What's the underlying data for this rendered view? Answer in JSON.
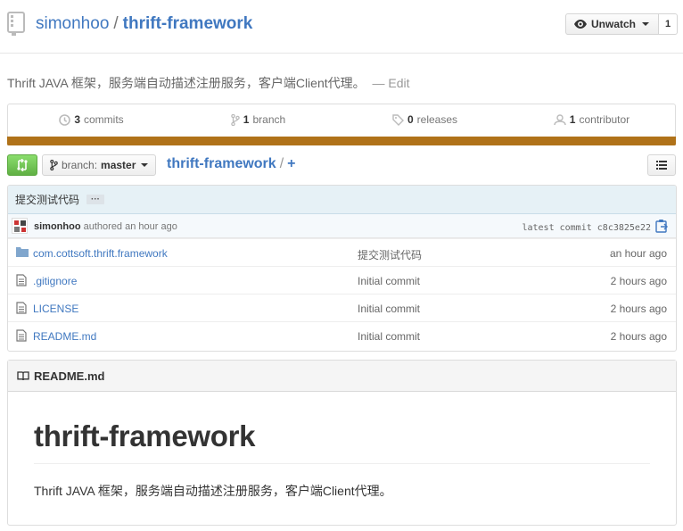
{
  "repo": {
    "owner": "simonhoo",
    "separator": "/",
    "name": "thrift-framework"
  },
  "watch": {
    "label": "Unwatch",
    "count": "1"
  },
  "description": {
    "text": "Thrift JAVA 框架，服务端自动描述注册服务，客户端Client代理。",
    "edit": "— Edit"
  },
  "summary": {
    "commits_count": "3",
    "commits_label": "commits",
    "branches_count": "1",
    "branches_label": "branch",
    "releases_count": "0",
    "releases_label": "releases",
    "contributors_count": "1",
    "contributors_label": "contributor",
    "language_color": "#b07219"
  },
  "nav": {
    "branch_label": "branch:",
    "branch_name": "master",
    "breadcrumb_root": "thrift-framework",
    "breadcrumb_sep": "/",
    "breadcrumb_add": "+"
  },
  "commit": {
    "message": "提交测试代码",
    "ellipsis": "···",
    "author": "simonhoo",
    "authored": "authored an hour ago",
    "latest_label": "latest commit",
    "sha": "c8c3825e22"
  },
  "files": [
    {
      "type": "folder-icon",
      "name": "com.cottsoft.thrift.framework",
      "message": "提交测试代码",
      "age": "an hour ago"
    },
    {
      "type": "file-icon",
      "name": ".gitignore",
      "message": "Initial commit",
      "age": "2 hours ago"
    },
    {
      "type": "file-icon",
      "name": "LICENSE",
      "message": "Initial commit",
      "age": "2 hours ago"
    },
    {
      "type": "file-icon",
      "name": "README.md",
      "message": "Initial commit",
      "age": "2 hours ago"
    }
  ],
  "readme": {
    "filename": "README.md",
    "heading": "thrift-framework",
    "paragraph": "Thrift JAVA 框架，服务端自动描述注册服务，客户端Client代理。"
  },
  "colors": {
    "link": "#4078c0",
    "compare_green": "#60b044",
    "commit_bar_bg": "#e6f1f6"
  }
}
